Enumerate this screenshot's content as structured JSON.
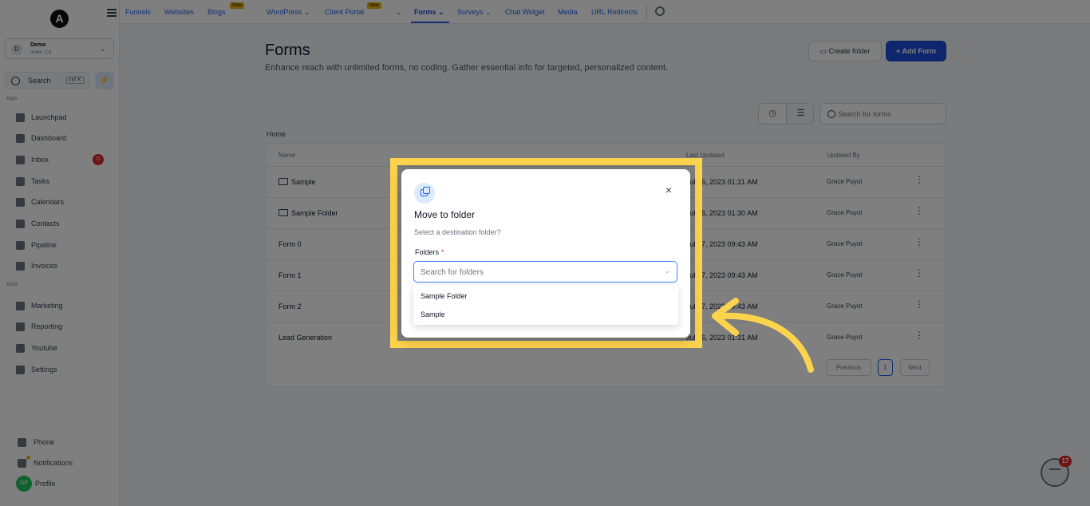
{
  "sidebar": {
    "logo_letter": "A",
    "account": {
      "name": "Demo",
      "location": "Irvine, CA",
      "avatar_initial": "D"
    },
    "search": {
      "label": "Search",
      "shortcut": "ctrl K"
    },
    "section_apps": "Apps",
    "section_tools": "Tools",
    "items": [
      {
        "label": "Launchpad",
        "icon": "rocket-icon"
      },
      {
        "label": "Dashboard",
        "icon": "dashboard-icon"
      },
      {
        "label": "Inbox",
        "icon": "inbox-icon",
        "badge": "0"
      },
      {
        "label": "Tasks",
        "icon": "tasks-icon"
      },
      {
        "label": "Calendars",
        "icon": "calendar-icon"
      },
      {
        "label": "Contacts",
        "icon": "contacts-icon"
      },
      {
        "label": "Pipeline",
        "icon": "pipeline-icon"
      },
      {
        "label": "Invoices",
        "icon": "invoice-icon"
      }
    ],
    "tools": [
      {
        "label": "Marketing",
        "icon": "megaphone-icon"
      },
      {
        "label": "Reporting",
        "icon": "chart-icon"
      },
      {
        "label": "Youtube",
        "icon": "youtube-icon"
      },
      {
        "label": "Settings",
        "icon": "gear-icon"
      }
    ],
    "bottom": [
      {
        "label": "Phone",
        "icon": "phone-icon"
      },
      {
        "label": "Notifications",
        "icon": "bell-icon"
      }
    ],
    "profile": {
      "label": "Profile",
      "initials": "GP"
    }
  },
  "topnav": {
    "items": [
      {
        "label": "Funnels"
      },
      {
        "label": "Websites"
      },
      {
        "label": "Blogs",
        "badge": "New"
      },
      {
        "label": "WordPress ⌄"
      },
      {
        "label": "Client Portal",
        "badge": "New"
      },
      {
        "label": "⌄"
      },
      {
        "label": "Forms ⌄",
        "active": true
      },
      {
        "label": "Surveys ⌄"
      },
      {
        "label": "Chat Widget"
      },
      {
        "label": "Media"
      },
      {
        "label": "URL Redirects"
      }
    ]
  },
  "page": {
    "title": "Forms",
    "description": "Enhance reach with unlimited forms, no coding. Gather essential info for targeted, personalized content.",
    "create_folder_label": "Create folder",
    "add_form_label": "+ Add Form",
    "search_placeholder": "Search for forms",
    "breadcrumb": "Home"
  },
  "table": {
    "headers": {
      "name": "Name",
      "updated": "Last Updated",
      "by": "Updated By"
    },
    "rows": [
      {
        "name": "Sample",
        "folder": true,
        "updated": "Jul 26, 2023 01:31 AM",
        "by": "Grace Puyot"
      },
      {
        "name": "Sample Folder",
        "folder": true,
        "updated": "Jul 26, 2023 01:30 AM",
        "by": "Grace Puyot"
      },
      {
        "name": "Form 0",
        "folder": false,
        "updated": "Jul 17, 2023 09:43 AM",
        "by": "Grace Puyot"
      },
      {
        "name": "Form 1",
        "folder": false,
        "updated": "Jul 17, 2023 09:43 AM",
        "by": "Grace Puyot"
      },
      {
        "name": "Form 2",
        "folder": false,
        "updated": "Jul 17, 2023 09:43 AM",
        "by": "Grace Puyot"
      },
      {
        "name": "Lead Generation",
        "folder": false,
        "updated": "Jul 26, 2023 01:31 AM",
        "by": "Grace Puyot"
      }
    ],
    "pagination": {
      "previous": "Previous",
      "current": "1",
      "next": "Next"
    }
  },
  "modal": {
    "title": "Move to folder",
    "subtitle": "Select a destination folder?",
    "field_label": "Folders",
    "required_mark": "*",
    "placeholder": "Search for folders",
    "close": "×",
    "options": [
      "Sample Folder",
      "Sample"
    ]
  },
  "chat": {
    "badge": "17"
  },
  "colors": {
    "accent": "#1d4ed8",
    "highlight": "#fcd34d",
    "danger": "#dc2626"
  }
}
